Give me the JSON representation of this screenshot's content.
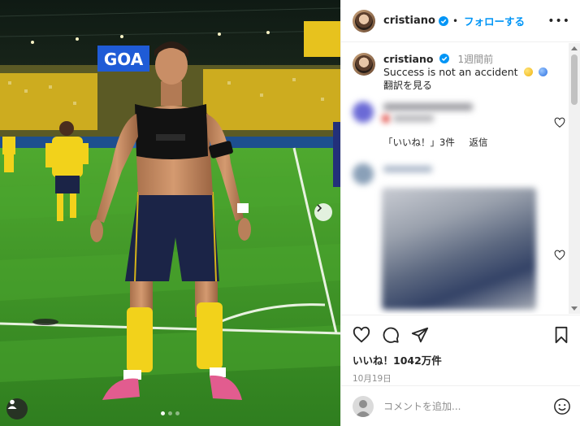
{
  "post": {
    "username": "cristiano",
    "follow_label": "フォローする",
    "separator": "•",
    "more_label": "•••"
  },
  "photo": {
    "billboard_text": "GOA",
    "icons": {
      "next": "chevron-right-icon",
      "tag": "person-icon"
    },
    "carousel": {
      "count": 3,
      "active": 1
    }
  },
  "caption": {
    "username": "cristiano",
    "time": "1週間前",
    "text": "Success is not an accident",
    "emojis": [
      "yellow-circle-emoji",
      "blue-circle-emoji"
    ],
    "translate": "翻訳を見る"
  },
  "comment_meta": {
    "likes": "「いいね！」3件",
    "reply": "返信"
  },
  "actions": {
    "icons": [
      "heart-icon",
      "comment-icon",
      "share-icon",
      "bookmark-icon"
    ],
    "likes": "いいね！1042万件",
    "date": "10月19日"
  },
  "add_comment": {
    "placeholder": "コメントを追加...",
    "emoji_icon": "smile-icon"
  },
  "colors": {
    "link": "#0095f6",
    "verified": "#0095f6",
    "text": "#262626",
    "muted": "#8e8e8e",
    "jersey_yellow": "#f2d21b",
    "pitch_green": "#3f9a2a"
  }
}
